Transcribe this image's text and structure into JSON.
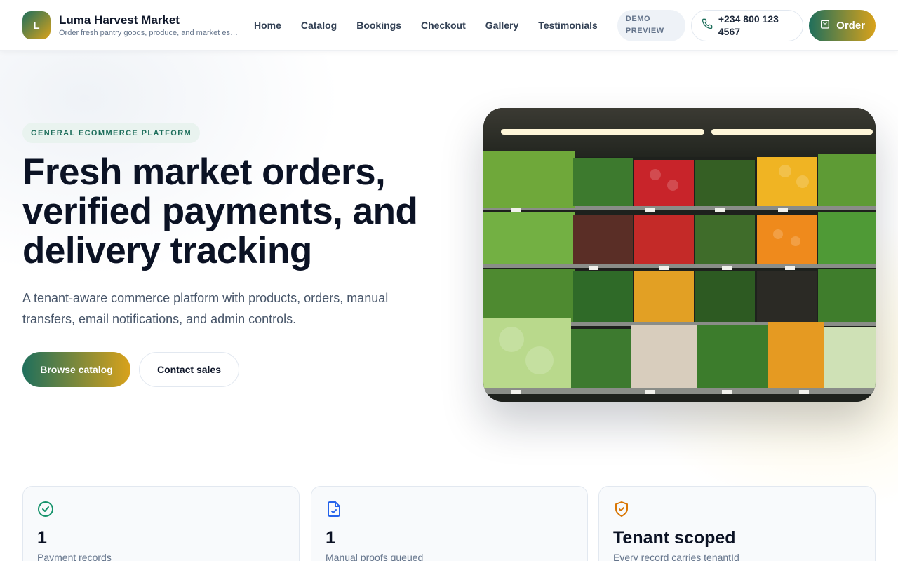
{
  "brand": {
    "logo_letter": "L",
    "name": "Luma Harvest Market",
    "tagline": "Order fresh pantry goods, produce, and market essentials"
  },
  "nav": {
    "items": [
      "Home",
      "Catalog",
      "Bookings",
      "Checkout",
      "Gallery",
      "Testimonials"
    ]
  },
  "header": {
    "demo_label": "DEMO PREVIEW",
    "phone": "+234 800 123 4567",
    "order_label": "Order"
  },
  "hero": {
    "badge": "GENERAL ECOMMERCE PLATFORM",
    "title": "Fresh market orders, verified payments, and delivery tracking",
    "subtitle": "A tenant-aware commerce platform with products, orders, manual transfers, email notifications, and admin controls.",
    "primary_cta": "Browse catalog",
    "secondary_cta": "Contact sales",
    "image_name": "produce-shelves-photo"
  },
  "stats": [
    {
      "icon": "check-circle-icon",
      "value": "1",
      "label": "Payment records"
    },
    {
      "icon": "file-check-icon",
      "value": "1",
      "label": "Manual proofs queued"
    },
    {
      "icon": "shield-check-icon",
      "value": "Tenant scoped",
      "label": "Every record carries tenantId"
    }
  ],
  "colors": {
    "brand_green": "#1f6f5c",
    "brand_gold": "#d9a21b",
    "text_dark": "#0b1224",
    "text_muted": "#64748b"
  }
}
